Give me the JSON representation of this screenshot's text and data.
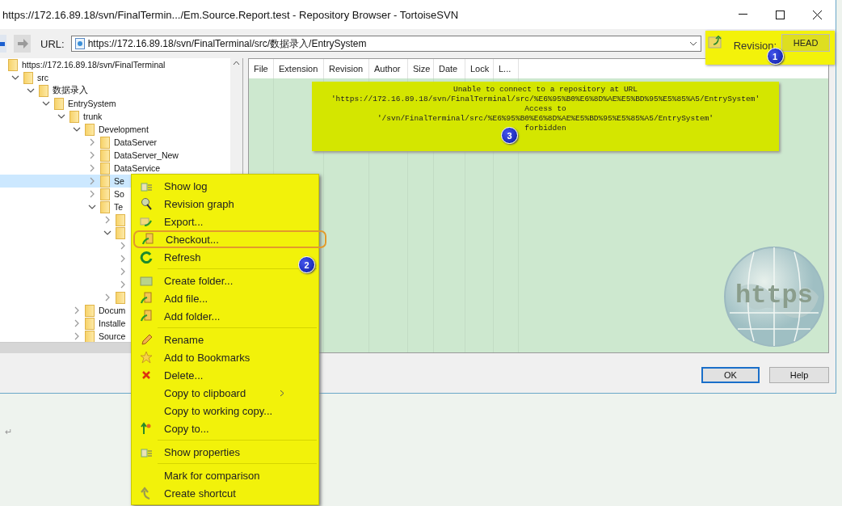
{
  "window": {
    "title": "https://172.16.89.18/svn/FinalTermin.../Em.Source.Report.test - Repository Browser - TortoiseSVN"
  },
  "toolbar": {
    "url_label": "URL:",
    "url": "https://172.16.89.18/svn/FinalTerminal/src/数据录入/EntrySystem",
    "revision_label": "Revision:",
    "revision_button": "HEAD",
    "badge": "1"
  },
  "tree": [
    {
      "label": "https://172.16.89.18/svn/FinalTerminal",
      "selected": false,
      "children": [
        {
          "label": "src",
          "expanded": true,
          "selected": false,
          "children": [
            {
              "label": "数据录入",
              "expanded": true,
              "selected": false,
              "children": [
                {
                  "label": "EntrySystem",
                  "expanded": true,
                  "selected": false,
                  "children": [
                    {
                      "label": "trunk",
                      "expanded": true,
                      "selected": false,
                      "children": [
                        {
                          "label": "Development",
                          "expanded": true,
                          "selected": false,
                          "children": [
                            {
                              "label": "DataServer",
                              "expanded": false,
                              "selected": false
                            },
                            {
                              "label": "DataServer_New",
                              "expanded": false,
                              "selected": false
                            },
                            {
                              "label": "DataService",
                              "expanded": false,
                              "selected": false
                            },
                            {
                              "label": "Se",
                              "expanded": false,
                              "selected": true
                            },
                            {
                              "label": "So",
                              "expanded": false,
                              "selected": false
                            },
                            {
                              "label": "Te",
                              "expanded": true,
                              "selected": false,
                              "children": [
                                {
                                  "expanded": false,
                                  "selected": false
                                },
                                {
                                  "expanded": true,
                                  "selected": false,
                                  "children": [
                                    {
                                      "expanded": false,
                                      "selected": false
                                    },
                                    {
                                      "expanded": false,
                                      "selected": false
                                    },
                                    {
                                      "expanded": false,
                                      "selected": false
                                    },
                                    {
                                      "expanded": false,
                                      "selected": false
                                    }
                                  ]
                                },
                                {
                                  "expanded": false,
                                  "selected": false
                                }
                              ]
                            }
                          ]
                        },
                        {
                          "label": "Docum",
                          "expanded": false,
                          "selected": false
                        },
                        {
                          "label": "Installe",
                          "expanded": false,
                          "selected": false
                        },
                        {
                          "label": "Source",
                          "expanded": false,
                          "selected": false
                        }
                      ]
                    }
                  ]
                }
              ]
            }
          ]
        }
      ]
    }
  ],
  "list": {
    "columns": [
      "File",
      "Extension",
      "Revision",
      "Author",
      "Size",
      "Date",
      "Lock",
      "L..."
    ],
    "error": {
      "lines": [
        "Unable to connect to a repository at URL",
        "'https://172.16.89.18/svn/FinalTerminal/src/%E6%95%B0%E6%8D%AE%E5%BD%95%E5%85%A5/EntrySystem'",
        "Access to",
        "'/svn/FinalTerminal/src/%E6%95%B0%E6%8D%AE%E5%BD%95%E5%85%A5/EntrySystem'",
        "forbidden"
      ],
      "badge": "3"
    },
    "globe_label": "https"
  },
  "buttons": [
    {
      "label": "OK",
      "default": true
    },
    {
      "label": "Help",
      "default": false
    }
  ],
  "context_menu": {
    "badge": "2",
    "groups": [
      [
        {
          "label": "Show log",
          "highlighted": false
        },
        {
          "label": "Revision graph",
          "highlighted": false
        },
        {
          "label": "Export...",
          "highlighted": false
        },
        {
          "label": "Checkout...",
          "highlighted": true
        },
        {
          "label": "Refresh",
          "highlighted": false
        }
      ],
      [
        {
          "label": "Create folder...",
          "highlighted": false
        },
        {
          "label": "Add file...",
          "highlighted": false
        },
        {
          "label": "Add folder...",
          "highlighted": false
        }
      ],
      [
        {
          "label": "Rename",
          "highlighted": false
        },
        {
          "label": "Add to Bookmarks",
          "highlighted": false
        },
        {
          "label": "Delete...",
          "highlighted": false
        },
        {
          "label": "Copy to clipboard",
          "highlighted": false,
          "submenu": true
        },
        {
          "label": "Copy to working copy...",
          "highlighted": false
        },
        {
          "label": "Copy to...",
          "highlighted": false
        }
      ],
      [
        {
          "label": "Show properties",
          "highlighted": false
        }
      ],
      [
        {
          "label": "Mark for comparison",
          "highlighted": false
        },
        {
          "label": "Create shortcut",
          "highlighted": false
        }
      ]
    ]
  },
  "page": {
    "return_mark": "↵"
  }
}
